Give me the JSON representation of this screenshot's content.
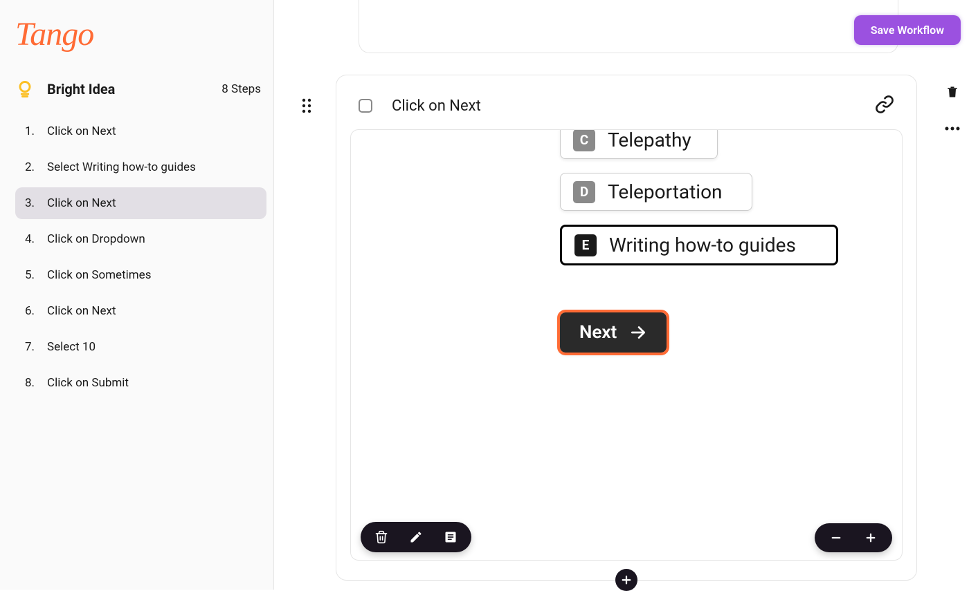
{
  "brand": "Tango",
  "workflow": {
    "title": "Bright Idea",
    "step_count": "8 Steps"
  },
  "steps": [
    {
      "num": "1.",
      "label": "Click on Next"
    },
    {
      "num": "2.",
      "label": "Select Writing how-to guides"
    },
    {
      "num": "3.",
      "label": "Click on Next"
    },
    {
      "num": "4.",
      "label": "Click on Dropdown"
    },
    {
      "num": "5.",
      "label": "Click on Sometimes"
    },
    {
      "num": "6.",
      "label": "Click on Next"
    },
    {
      "num": "7.",
      "label": "Select 10"
    },
    {
      "num": "8.",
      "label": "Click on Submit"
    }
  ],
  "active_step_index": 2,
  "card": {
    "title": "Click on Next"
  },
  "screenshot": {
    "options": [
      {
        "letter": "C",
        "text": "Telepathy"
      },
      {
        "letter": "D",
        "text": "Teleportation"
      },
      {
        "letter": "E",
        "text": "Writing how-to guides"
      }
    ],
    "next_button": "Next"
  },
  "actions": {
    "save": "Save Workflow"
  },
  "colors": {
    "brand": "#ff6b35",
    "accent": "#9b51e0",
    "dark": "#1a1520"
  }
}
